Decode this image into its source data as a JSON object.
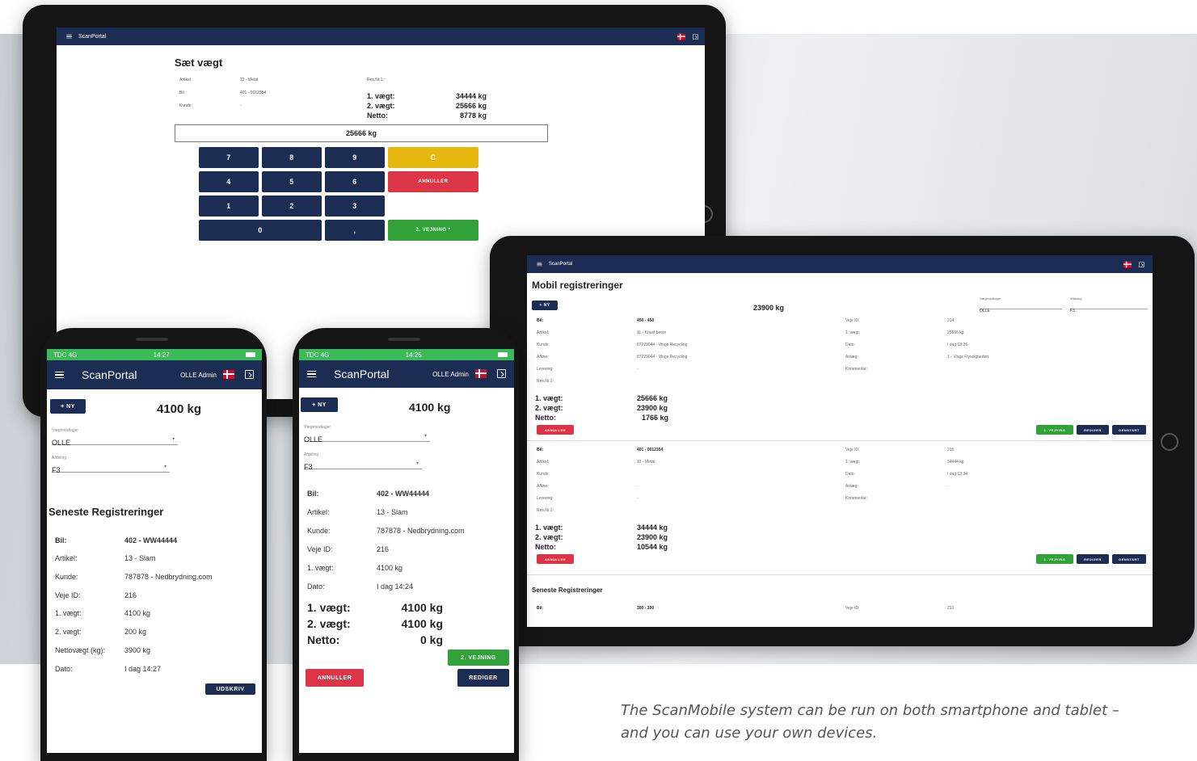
{
  "caption": {
    "line1": "The ScanMobile system can be run on both smartphone and tablet –",
    "line2": "and you can use your own devices."
  },
  "tablet_keypad": {
    "app_title": "ScanPortal",
    "page_title": "Sæt vægt",
    "labels": [
      "Artikel:",
      "Bil:",
      "Kunde:"
    ],
    "values": [
      "12 - Metal",
      "401 - 0012354",
      "-"
    ],
    "ref_label": "Res.Nr.1:",
    "weights": [
      {
        "label": "1. vægt:",
        "value": "34444 kg"
      },
      {
        "label": "2. vægt:",
        "value": "25666 kg"
      },
      {
        "label": "Netto:",
        "value": "8778 kg"
      }
    ],
    "display": "25666 kg",
    "keys": {
      "k7": "7",
      "k8": "8",
      "k9": "9",
      "kc": "C",
      "k4": "4",
      "k5": "5",
      "k6": "6",
      "cancel": "ANNULLER",
      "k1": "1",
      "k2": "2",
      "k3": "3",
      "k0": "0",
      "comma": ",",
      "second": "2. VEJNING *"
    },
    "colors": {
      "navy": "#1b2d52",
      "cancel": "#dc3545",
      "clear": "#e6b80e",
      "confirm": "#33a13a"
    }
  },
  "tablet_list": {
    "app_title": "ScanPortal",
    "page_title": "Mobil registreringer",
    "new_button": "+ NY",
    "weight": "23900 kg",
    "select1_label": "Vægtmodtager",
    "select1_value": "OLLE",
    "select2_label": "Afdeling",
    "select2_value": "F3",
    "records": [
      {
        "left_labels": [
          "Bil:",
          "Artikel:",
          "Kunde:",
          "Afføre:",
          "Levering:",
          "Res.Nr.1:"
        ],
        "left_values": [
          "450 - 450",
          "11 - Knust beton",
          "87229044 - Vinge Recycling",
          "87229044 - Vinge Recycling",
          "-",
          ""
        ],
        "right_labels": [
          "Veje ID:",
          "1. vægt:",
          "Dato:",
          "Anlæg:",
          "Kommentar:"
        ],
        "right_values": [
          "214",
          "25666 kg",
          "I dag 13:26",
          "1 - Vinge Flyselgheden",
          ""
        ],
        "weights": [
          {
            "label": "1. vægt:",
            "value": "25666 kg"
          },
          {
            "label": "2. vægt:",
            "value": "23900 kg"
          },
          {
            "label": "Netto:",
            "value": "1766 kg"
          }
        ]
      },
      {
        "left_labels": [
          "Bil:",
          "Artikel:",
          "Kunde:",
          "Afføre:",
          "Levering:",
          "Res.Nr.1:"
        ],
        "left_values": [
          "401 - 0012354",
          "12 - Metal",
          "",
          "-",
          "-",
          ""
        ],
        "right_labels": [
          "Veje ID:",
          "1. vægt:",
          "Dato:",
          "Anlæg:",
          "Kommentar:"
        ],
        "right_values": [
          "215",
          "34444 kg",
          "I dag 13:34",
          "-",
          ""
        ],
        "weights": [
          {
            "label": "1. vægt:",
            "value": "34444 kg"
          },
          {
            "label": "2. vægt:",
            "value": "23900 kg"
          },
          {
            "label": "Netto:",
            "value": "10544 kg"
          }
        ]
      }
    ],
    "cancel": "ANNULLER",
    "second": "2. VEJNING",
    "edit": "REDIGER",
    "restart": "GENSTART",
    "latest_heading": "Seneste Registreringer",
    "latest_row": {
      "label": "Bil:",
      "value": "300 - 300",
      "id_label": "Veje ID:",
      "id_value": "213"
    }
  },
  "phone_left": {
    "status_left": "TDC 4G",
    "status_time": "14:27",
    "app_title": "ScanPortal",
    "user": "OLLE Admin",
    "new_button": "+ NY",
    "weight": "4100 kg",
    "field1_label": "Vægtmodtager",
    "field1_value": "OLLE",
    "field2_label": "Afdeling",
    "field2_value": "F3",
    "heading": "Seneste Registreringer",
    "rows": [
      {
        "label": "Bil:",
        "value": "402 - WW44444"
      },
      {
        "label": "Artikel:",
        "value": "13 - Slam"
      },
      {
        "label": "Kunde:",
        "value": "787878 - Nedbrydning.com"
      },
      {
        "label": "Veje ID:",
        "value": "216"
      },
      {
        "label": "1. vægt:",
        "value": "4100 kg"
      },
      {
        "label": "2. vægt:",
        "value": "200 kg"
      },
      {
        "label": "Nettovægt (kg):",
        "value": "3900 kg"
      },
      {
        "label": "Dato:",
        "value": "I dag 14:27"
      }
    ],
    "action": "UDSKRIV"
  },
  "phone_right": {
    "status_left": "TDC 4G",
    "status_time": "14:25",
    "app_title": "ScanPortal",
    "user": "OLLE Admin",
    "new_button": "+ NY",
    "weight": "4100 kg",
    "field1_label": "Vægtmodtager",
    "field1_value": "OLLE",
    "field2_label": "Afdeling",
    "field2_value": "F3",
    "rows": [
      {
        "label": "Bil:",
        "value": "402 - WW44444"
      },
      {
        "label": "Artikel:",
        "value": "13 - Slam"
      },
      {
        "label": "Kunde:",
        "value": "787878 - Nedbrydning.com"
      },
      {
        "label": "Veje ID:",
        "value": "216"
      },
      {
        "label": "1. vægt:",
        "value": "4100 kg"
      },
      {
        "label": "Dato:",
        "value": "I dag 14:24"
      }
    ],
    "weights": [
      {
        "label": "1. vægt:",
        "value": "4100 kg"
      },
      {
        "label": "2. vægt:",
        "value": "4100 kg"
      },
      {
        "label": "Netto:",
        "value": "0 kg"
      }
    ],
    "second": "2. VEJNING",
    "cancel": "ANNULLER",
    "edit": "REDIGER"
  }
}
